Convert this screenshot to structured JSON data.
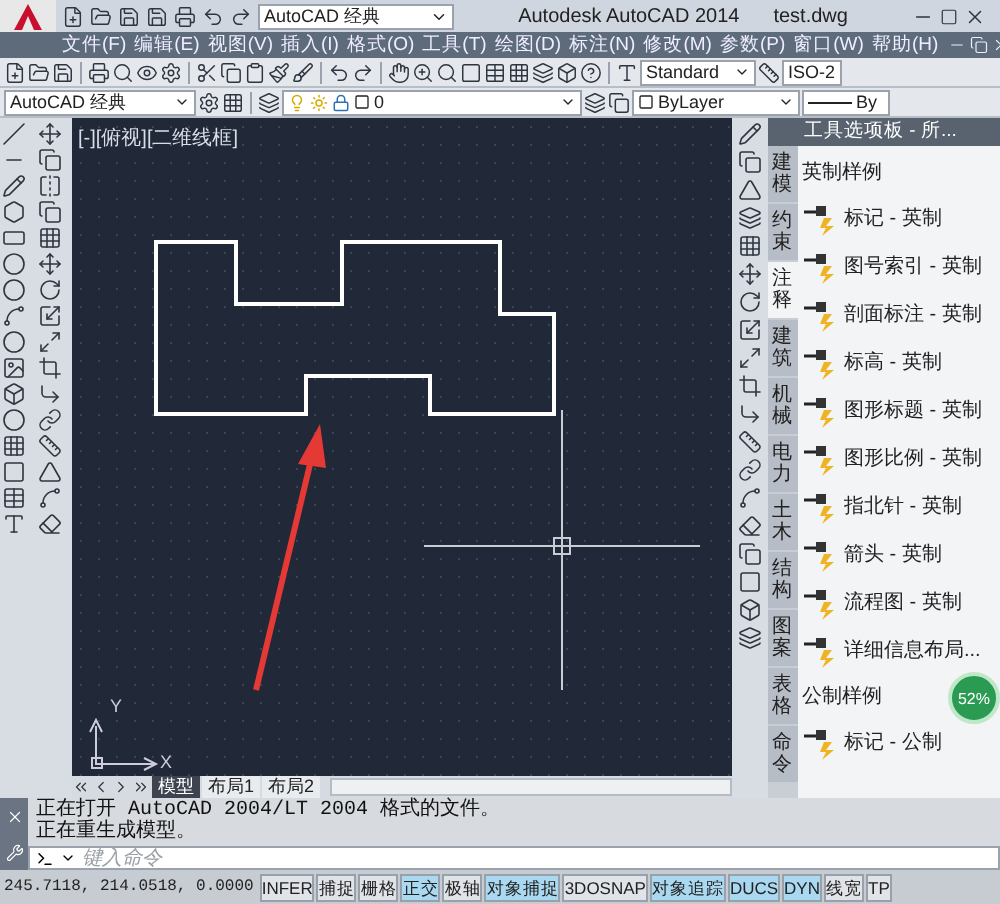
{
  "title_bar": {
    "workspace": "AutoCAD 经典",
    "app_title": "Autodesk AutoCAD 2014",
    "file_name": "test.dwg"
  },
  "menu": [
    {
      "label": "文件(F)"
    },
    {
      "label": "编辑(E)"
    },
    {
      "label": "视图(V)"
    },
    {
      "label": "插入(I)"
    },
    {
      "label": "格式(O)"
    },
    {
      "label": "工具(T)"
    },
    {
      "label": "绘图(D)"
    },
    {
      "label": "标注(N)"
    },
    {
      "label": "修改(M)"
    },
    {
      "label": "参数(P)"
    },
    {
      "label": "窗口(W)"
    },
    {
      "label": "帮助(H)"
    }
  ],
  "toolbar": {
    "text_style": "Standard",
    "dim_style": "ISO-2"
  },
  "layers_bar": {
    "workspace": "AutoCAD 经典",
    "layer": "0",
    "color_setting": "ByLayer",
    "linetype": "By"
  },
  "viewport": {
    "label": "[-][俯视][二维线框]",
    "ucs_y": "Y",
    "ucs_x": "X"
  },
  "layout_tabs": [
    {
      "label": "模型",
      "selected": true
    },
    {
      "label": "布局1",
      "selected": false
    },
    {
      "label": "布局2",
      "selected": false
    }
  ],
  "palette": {
    "title": "工具选项板 - 所...",
    "tabs": [
      {
        "label": "建模",
        "selected": false
      },
      {
        "label": "约束",
        "selected": false
      },
      {
        "label": "注释",
        "selected": true
      },
      {
        "label": "建筑",
        "selected": false
      },
      {
        "label": "机械",
        "selected": false
      },
      {
        "label": "电力",
        "selected": false
      },
      {
        "label": "土木",
        "selected": false
      },
      {
        "label": "结构",
        "selected": false
      },
      {
        "label": "图案",
        "selected": false
      },
      {
        "label": "表格",
        "selected": false
      },
      {
        "label": "命令",
        "selected": false
      }
    ],
    "items": [
      {
        "kind": "header",
        "label": "英制样例"
      },
      {
        "kind": "tool",
        "label": "标记 - 英制"
      },
      {
        "kind": "tool",
        "label": "图号索引 - 英制"
      },
      {
        "kind": "tool",
        "label": "剖面标注 - 英制"
      },
      {
        "kind": "tool",
        "label": "标高 - 英制"
      },
      {
        "kind": "tool",
        "label": "图形标题 - 英制"
      },
      {
        "kind": "tool",
        "label": "图形比例 - 英制"
      },
      {
        "kind": "tool",
        "label": "指北针 - 英制"
      },
      {
        "kind": "tool",
        "label": "箭头 - 英制"
      },
      {
        "kind": "tool",
        "label": "流程图 - 英制"
      },
      {
        "kind": "tool",
        "label": "详细信息布局..."
      },
      {
        "kind": "header",
        "label": "公制样例"
      },
      {
        "kind": "tool",
        "label": "标记 - 公制"
      }
    ]
  },
  "speed_ball": "52%",
  "command": {
    "history": [
      "正在打开 AutoCAD 2004/LT 2004 格式的文件。",
      "正在重生成模型。"
    ],
    "placeholder": "键入命令"
  },
  "status_bar": {
    "coordinates": "245.7118, 214.0518, 0.0000",
    "toggles": [
      {
        "label": "INFER",
        "selected": false
      },
      {
        "label": "捕捉",
        "selected": false
      },
      {
        "label": "栅格",
        "selected": false
      },
      {
        "label": "正交",
        "selected": true
      },
      {
        "label": "极轴",
        "selected": false
      },
      {
        "label": "对象捕捉",
        "selected": true
      },
      {
        "label": "3DOSNAP",
        "selected": false
      },
      {
        "label": "对象追踪",
        "selected": true
      },
      {
        "label": "DUCS",
        "selected": true
      },
      {
        "label": "DYN",
        "selected": true
      },
      {
        "label": "线宽",
        "selected": false
      },
      {
        "label": "TP",
        "selected": false
      }
    ]
  }
}
